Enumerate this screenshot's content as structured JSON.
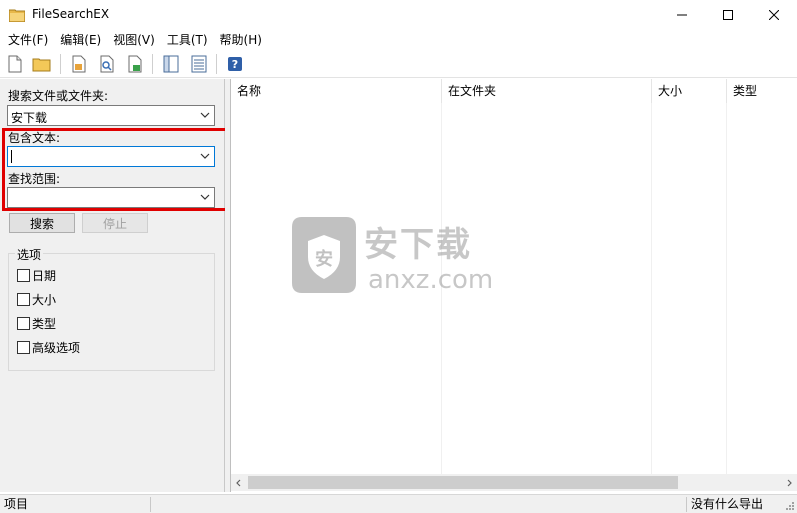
{
  "window": {
    "title": "FileSearchEX"
  },
  "menu": [
    "文件(F)",
    "编辑(E)",
    "视图(V)",
    "工具(T)",
    "帮助(H)"
  ],
  "toolbar": {
    "icons": [
      "new-file-icon",
      "open-folder-icon",
      "save-search-icon",
      "find-in-file-icon",
      "export-icon",
      "panel-toggle-icon",
      "columns-icon",
      "help-icon"
    ]
  },
  "search_panel": {
    "name_label": "搜索文件或文件夹:",
    "name_value": "安下载",
    "text_label": "包含文本:",
    "text_value": "",
    "scope_label": "查找范围:",
    "scope_value": "",
    "search_button": "搜索",
    "stop_button": "停止",
    "options_title": "选项",
    "options": [
      {
        "label": "日期",
        "checked": false
      },
      {
        "label": "大小",
        "checked": false
      },
      {
        "label": "类型",
        "checked": false
      },
      {
        "label": "高级选项",
        "checked": false
      }
    ]
  },
  "results": {
    "columns": [
      "名称",
      "在文件夹",
      "大小",
      "类型"
    ],
    "rows": []
  },
  "watermark": {
    "cn": "安下载",
    "en": "anxz.com"
  },
  "status": {
    "left": "项目",
    "right": "没有什么导出"
  },
  "colors": {
    "highlight": "#e00000",
    "focus": "#0078d7"
  }
}
